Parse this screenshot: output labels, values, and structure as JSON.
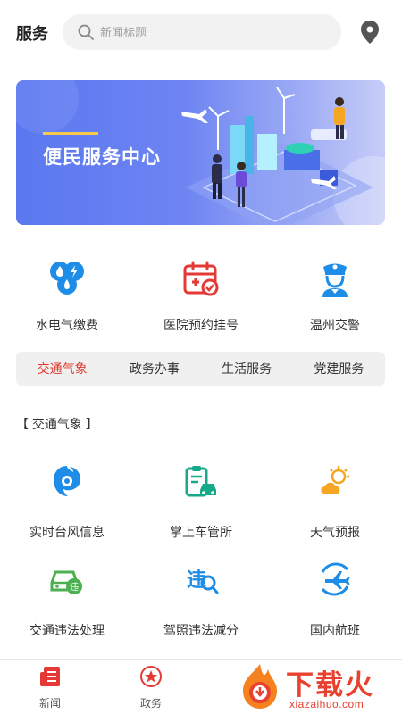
{
  "header": {
    "title": "服务",
    "search_placeholder": "新闻标题",
    "search_icon": "search-icon",
    "location_icon": "location-pin-icon"
  },
  "banner": {
    "title": "便民服务中心"
  },
  "quick_services": [
    {
      "label": "水电气缴费",
      "icon": "utilities-icon",
      "color": "#1e8de8"
    },
    {
      "label": "医院预约挂号",
      "icon": "hospital-calendar-icon",
      "color": "#e53935"
    },
    {
      "label": "温州交警",
      "icon": "police-icon",
      "color": "#1e8de8"
    }
  ],
  "tabs": [
    {
      "label": "交通气象",
      "active": true
    },
    {
      "label": "政务办事",
      "active": false
    },
    {
      "label": "生活服务",
      "active": false
    },
    {
      "label": "党建服务",
      "active": false
    }
  ],
  "section": {
    "title": "【 交通气象 】"
  },
  "grid_items": [
    {
      "label": "实时台风信息",
      "icon": "typhoon-icon",
      "color": "#1e8de8"
    },
    {
      "label": "掌上车管所",
      "icon": "vehicle-office-icon",
      "color": "#16a98a"
    },
    {
      "label": "天气预报",
      "icon": "weather-icon",
      "color": "#f5a623"
    },
    {
      "label": "交通违法处理",
      "icon": "traffic-violation-car-icon",
      "color": "#4caf50"
    },
    {
      "label": "驾照违法减分",
      "icon": "license-violation-icon",
      "color": "#1e8de8"
    },
    {
      "label": "国内航班",
      "icon": "airplane-icon",
      "color": "#1e8de8"
    }
  ],
  "bottom_nav": [
    {
      "label": "新闻",
      "icon": "news-icon",
      "color": "#e53935"
    },
    {
      "label": "政务",
      "icon": "star-badge-icon",
      "color": "#e53935"
    }
  ],
  "watermark": {
    "text": "下载火",
    "sub": "xiazaihuo.com"
  },
  "colors": {
    "accent": "#e0392b",
    "banner_start": "#5b78f0",
    "banner_end": "#c7cdf8"
  }
}
